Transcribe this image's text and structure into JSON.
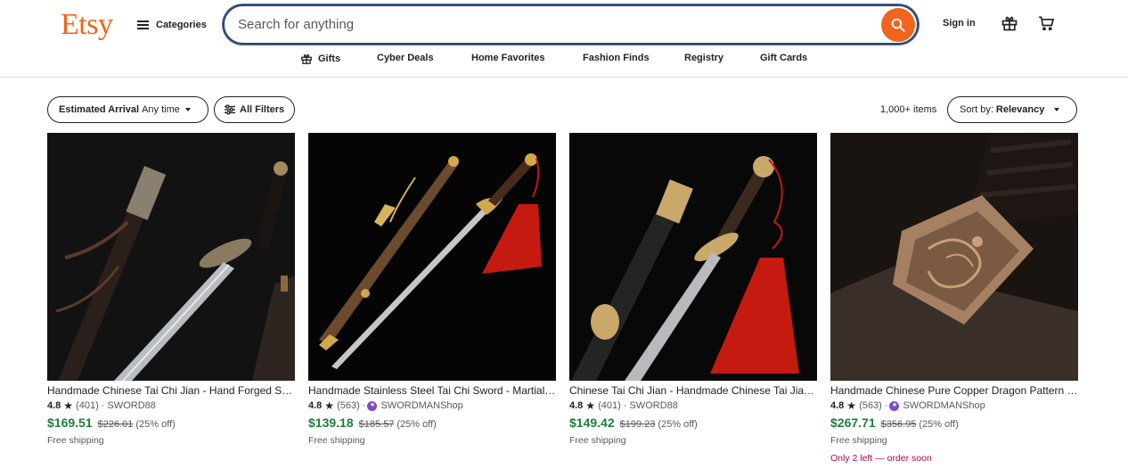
{
  "header": {
    "logo": "Etsy",
    "categories_label": "Categories",
    "search_placeholder": "Search for anything",
    "signin_label": "Sign in"
  },
  "nav": {
    "items": [
      "Gifts",
      "Cyber Deals",
      "Home Favorites",
      "Fashion Finds",
      "Registry",
      "Gift Cards"
    ]
  },
  "filters": {
    "arrival_label": "Estimated Arrival",
    "arrival_value": "Any time",
    "all_filters_label": "All Filters",
    "count_label": "1,000+ items",
    "sort_label": "Sort by:",
    "sort_value": "Relevancy"
  },
  "products": [
    {
      "title": "Handmade Chinese Tai Chi Jian - Hand Forged Sword",
      "rating": "4.8",
      "reviews": "(401) ·",
      "shop": "SWORD88",
      "price": "$169.51",
      "original_price": "$226.01",
      "discount": "(25% off)",
      "shipping": "Free shipping"
    },
    {
      "title": "Handmade Stainless Steel Tai Chi Sword - Martial Arts",
      "rating": "4.8",
      "reviews": "(563) ·",
      "shop": "SWORDMANShop",
      "price": "$139.18",
      "original_price": "$185.57",
      "discount": "(25% off)",
      "shipping": "Free shipping"
    },
    {
      "title": "Chinese Tai Chi Jian - Handmade Chinese Tai Jian Sword",
      "rating": "4.8",
      "reviews": "(401) ·",
      "shop": "SWORD88",
      "price": "$149.42",
      "original_price": "$199.23",
      "discount": "(25% off)",
      "shipping": "Free shipping"
    },
    {
      "title": "Handmade Chinese Pure Copper Dragon Pattern Sword",
      "rating": "4.8",
      "reviews": "(563) ·",
      "shop": "SWORDMANShop",
      "price": "$267.71",
      "original_price": "$356.95",
      "discount": "(25% off)",
      "shipping": "Free shipping",
      "urgency": "Only 2 left — order soon"
    }
  ],
  "icons": {
    "menu": "hamburger-icon",
    "search": "search-icon",
    "gift": "gift-icon",
    "cart": "cart-icon",
    "filter": "sliders-icon",
    "star_seller": "star-seller-badge-icon"
  },
  "colors": {
    "brand": "#f1641e",
    "price": "#1e7d3d",
    "urgency": "#b2044b",
    "star_seller": "#7b4bc8"
  }
}
